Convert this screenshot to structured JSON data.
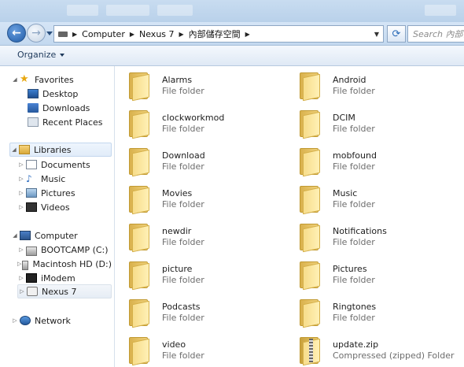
{
  "address": {
    "crumbs": [
      "Computer",
      "Nexus 7",
      "內部儲存空間"
    ],
    "search_placeholder": "Search 內部儲存"
  },
  "toolbar": {
    "organize_label": "Organize"
  },
  "nav": {
    "favorites_label": "Favorites",
    "favorites": [
      "Desktop",
      "Downloads",
      "Recent Places"
    ],
    "libraries_label": "Libraries",
    "libraries": [
      "Documents",
      "Music",
      "Pictures",
      "Videos"
    ],
    "computer_label": "Computer",
    "computer": [
      "BOOTCAMP (C:)",
      "Macintosh HD (D:)",
      "iModem",
      "Nexus 7"
    ],
    "network_label": "Network"
  },
  "items": [
    {
      "name": "Alarms",
      "type": "File folder"
    },
    {
      "name": "Android",
      "type": "File folder"
    },
    {
      "name": "clockworkmod",
      "type": "File folder"
    },
    {
      "name": "DCIM",
      "type": "File folder"
    },
    {
      "name": "Download",
      "type": "File folder"
    },
    {
      "name": "mobfound",
      "type": "File folder"
    },
    {
      "name": "Movies",
      "type": "File folder"
    },
    {
      "name": "Music",
      "type": "File folder"
    },
    {
      "name": "newdir",
      "type": "File folder"
    },
    {
      "name": "Notifications",
      "type": "File folder"
    },
    {
      "name": "picture",
      "type": "File folder"
    },
    {
      "name": "Pictures",
      "type": "File folder"
    },
    {
      "name": "Podcasts",
      "type": "File folder"
    },
    {
      "name": "Ringtones",
      "type": "File folder"
    },
    {
      "name": "video",
      "type": "File folder"
    },
    {
      "name": "update.zip",
      "type": "Compressed (zipped) Folder"
    }
  ]
}
